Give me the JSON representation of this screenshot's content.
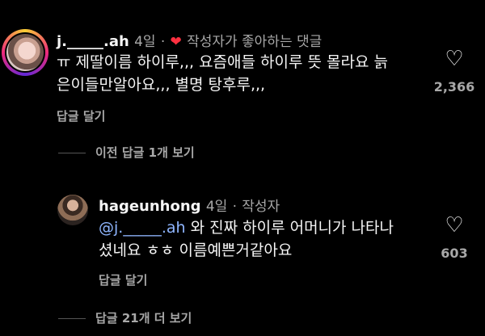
{
  "comment1": {
    "username": "j._____.ah",
    "time": "4일",
    "separator": "·",
    "liked_label": "작성자가 좋아하는 댓글",
    "text_line1": "ㅠ 제딸이름 하이루,,, 요즘애들 하이루 뜻 몰라요 늙",
    "text_line2": "은이들만알아요,,, 별명 탕후루,,,",
    "reply_label": "답글 달기",
    "like_count": "2,366"
  },
  "view_previous": {
    "label": "이전 답글 1개 보기"
  },
  "comment2": {
    "username": "hageunhong",
    "time": "4일",
    "separator": "·",
    "author_label": "작성자",
    "mention": "@j._____.ah",
    "text_line1_rest": " 와 진짜 하이루 어머니가 나타나",
    "text_line2": "셨네요 ㅎㅎ 이름예쁜거같아요",
    "reply_label": "답글 달기",
    "like_count": "603"
  },
  "view_more": {
    "label": "답글 21개 더 보기"
  },
  "colors": {
    "background": "#000000",
    "text": "#f5f5f5",
    "muted": "#a8a8a8",
    "mention": "#8fb6ff",
    "liked_heart": "#ff3040"
  }
}
